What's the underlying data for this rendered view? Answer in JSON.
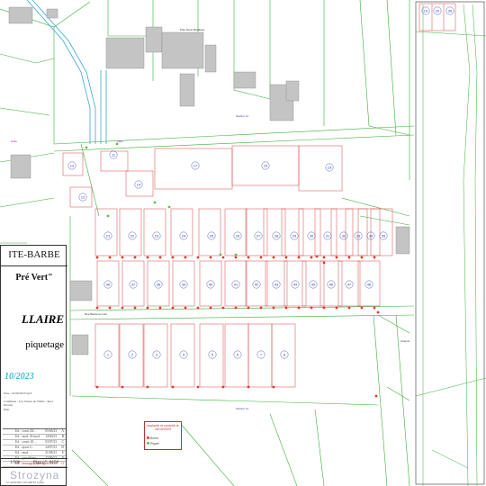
{
  "title_block": {
    "commune": "ITE-BARBE",
    "lotissement": "Pré Vert\"",
    "kind": "LLAIRE",
    "plan_title": "piquetage",
    "date": "10/2023",
    "info_lines": [
      "Date : 01/09/2023 bj19",
      "...",
      "Commune - Les Vernes de Villers - Reol",
      "Dossier",
      "Plan"
    ],
    "revisions": [
      {
        "label": "Ed. : contr 20/...",
        "date": "05/06/23",
        "ind": "A"
      },
      {
        "label": "Ed. : mod. 20 mod.",
        "date": "14/06/23",
        "ind": "B"
      },
      {
        "label": "Ed. : contr. 20 ...",
        "date": "03/07/23",
        "ind": "C"
      },
      {
        "label": "Ed. : ajout 2...",
        "date": "24/07/23",
        "ind": "D"
      },
      {
        "label": "Ed. : mod. ...",
        "date": "31/08/23",
        "ind": "E"
      },
      {
        "label": "Ed. : parcellaire...",
        "date": "13/09/23",
        "ind": "F"
      },
      {
        "label": "Ed. : bornage/piquetage",
        "date": "16/10/23",
        "ind": "G",
        "highlight": true
      }
    ],
    "scale": "1/500",
    "plan_no_label": "Plan n°",
    "plan_no": "8158",
    "firm": "Strozyna",
    "address": "57 ANTONY LES METZ Cedex"
  },
  "legend": {
    "title": "Implanté et contrôlé le 16/10/2023",
    "items": [
      {
        "label": "Borne",
        "color": "#e03a2a"
      },
      {
        "label": "Piquet",
        "color": "#5fbf4a"
      }
    ]
  },
  "map": {
    "street_label": "Rue Basse la Cure",
    "sections": [
      "Section 11",
      "Section 11",
      "Section 8"
    ],
    "building_label": "Pôle Fleuri Basilique",
    "lieux": [
      "Dalla",
      "Zaltu"
    ],
    "chemin_label": "Chemin",
    "lot_numbers_top": [
      "13",
      "11",
      "17",
      "15",
      "19",
      "14",
      "12"
    ],
    "lot_numbers_mid": [
      "21",
      "22",
      "23",
      "24",
      "25",
      "26",
      "27",
      "28",
      "29",
      "30",
      "31",
      "32",
      "33",
      "34",
      "35"
    ],
    "lot_numbers_lower": [
      "36",
      "37",
      "38",
      "39",
      "40",
      "41",
      "42",
      "43",
      "44",
      "45",
      "46",
      "47",
      "48"
    ],
    "lot_numbers_bottom": [
      "1",
      "2",
      "3",
      "4",
      "5",
      "6",
      "7",
      "8"
    ],
    "right_panel_numbers": [
      "10",
      "20",
      "30"
    ]
  },
  "colors": {
    "parcel_line": "#3cae3c",
    "lot_line": "#d64545",
    "building": "#bdbdbd",
    "water": "#3aa6d6",
    "lot_number": "#2a3aa8",
    "boundary": "#8fd08f"
  }
}
